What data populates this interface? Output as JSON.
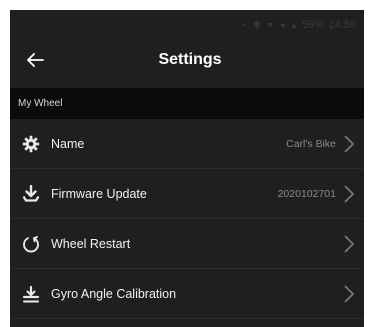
{
  "status_bar": {
    "battery": "59%",
    "time": "14:59"
  },
  "app_bar": {
    "title": "Settings"
  },
  "section": {
    "header": "My Wheel"
  },
  "rows": [
    {
      "label": "Name",
      "value": "Carl's Bike",
      "icon": "gear-icon"
    },
    {
      "label": "Firmware Update",
      "value": "2020102701",
      "icon": "download-icon"
    },
    {
      "label": "Wheel Restart",
      "value": "",
      "icon": "restart-icon"
    },
    {
      "label": "Gyro Angle Calibration",
      "value": "",
      "icon": "calibration-icon"
    }
  ]
}
